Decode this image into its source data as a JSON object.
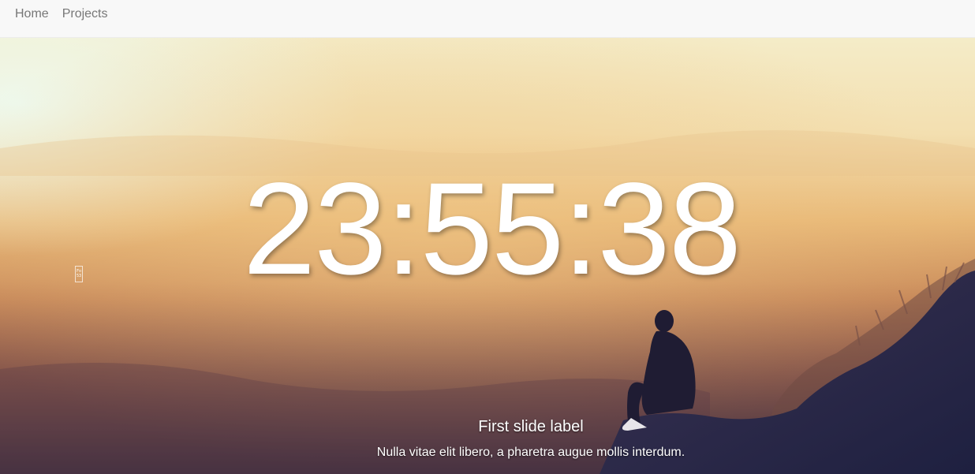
{
  "navbar": {
    "links": [
      {
        "label": "Home"
      },
      {
        "label": "Projects"
      }
    ]
  },
  "hero": {
    "time": "23:55:38",
    "widget": {
      "line1": "Fo",
      "line2": "53"
    },
    "caption": {
      "title": "First slide label",
      "text": "Nulla vitae elit libero, a pharetra augue mollis interdum."
    }
  }
}
